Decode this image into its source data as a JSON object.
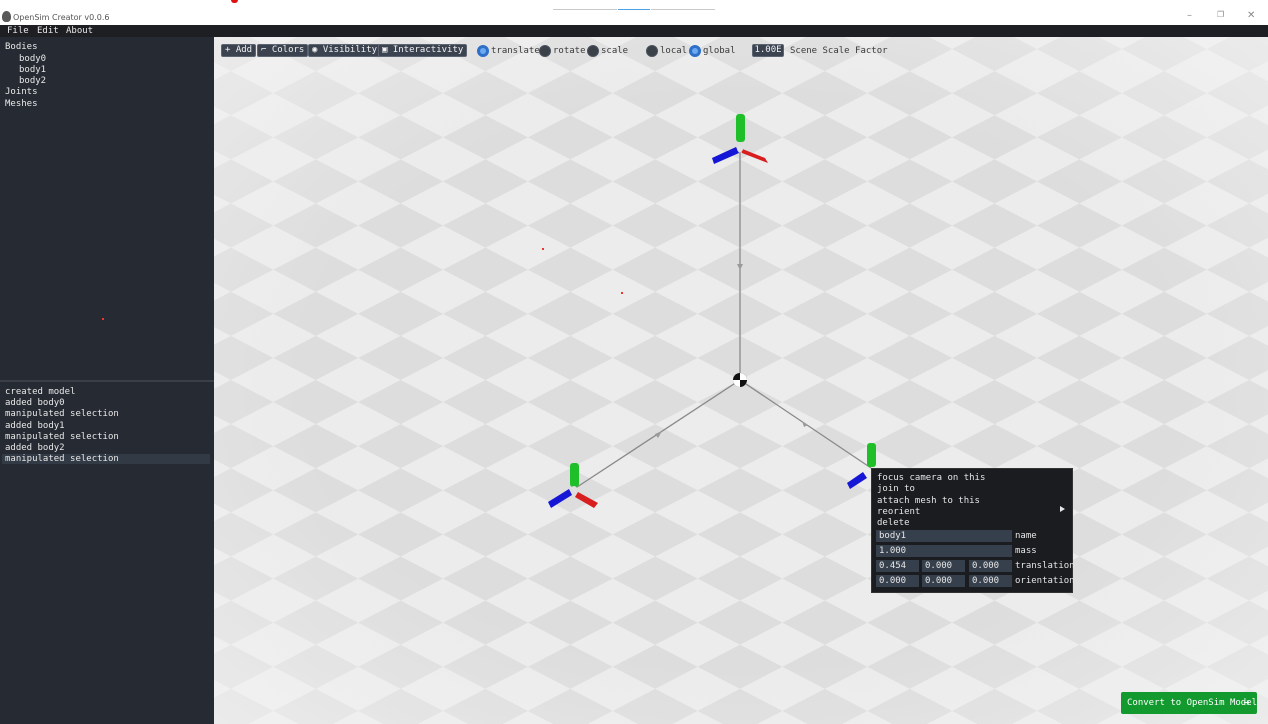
{
  "window": {
    "title": "OpenSim Creator v0.0.6",
    "controls": {
      "minimize": "–",
      "maximize": "❐",
      "close": "✕"
    }
  },
  "menu": {
    "items": [
      "File",
      "Edit",
      "About"
    ]
  },
  "hierarchy": {
    "bodies_label": "Bodies",
    "bodies": [
      "body0",
      "body1",
      "body2"
    ],
    "joints_label": "Joints",
    "meshes_label": "Meshes"
  },
  "history": {
    "items": [
      "created model",
      "added body0",
      "manipulated selection",
      "added body1",
      "manipulated selection",
      "added body2",
      "manipulated selection"
    ],
    "selected_index": 6
  },
  "toolbar": {
    "add_label": "Add",
    "colors_label": "Colors",
    "visibility_label": "Visibility",
    "interactivity_label": "Interactivity",
    "manip_modes": [
      "translate",
      "rotate",
      "scale"
    ],
    "manip_selected": "translate",
    "frames": [
      "local",
      "global"
    ],
    "frame_selected": "global",
    "scale_factor_value": "1.00E",
    "scale_factor_label": "Scene Scale Factor"
  },
  "context_menu": {
    "items": [
      "focus camera on this",
      "join to",
      "attach mesh to this",
      "reorient",
      "delete"
    ],
    "name_value": "body1",
    "name_label": "name",
    "mass_value": "1.000",
    "mass_label": "mass",
    "translation_values": [
      "0.454",
      "0.000",
      "0.000"
    ],
    "translation_label": "translation",
    "orientation_values": [
      "0.000",
      "0.000",
      "0.000"
    ],
    "orientation_label": "orientation"
  },
  "convert_button": {
    "label": "Convert to OpenSim Model",
    "arrow": "➔"
  },
  "colors": {
    "panel_bg": "#262b33",
    "accent_blue": "#2e6fc8",
    "convert_green": "#129a2f",
    "axis_x": "#d81e1e",
    "axis_y": "#1fbf2a",
    "axis_z": "#1616d6"
  }
}
